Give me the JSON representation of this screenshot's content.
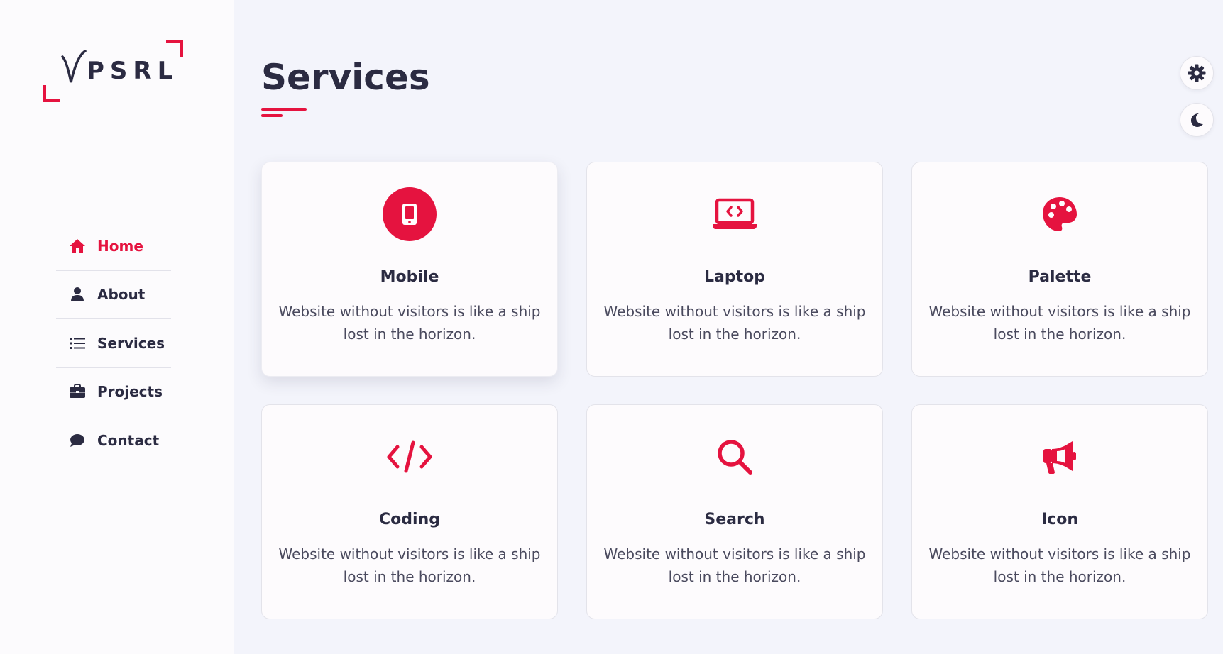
{
  "brand": {
    "logo_text": "PSRL",
    "accent": "#e5133f",
    "text_color": "#2b2b42"
  },
  "nav": {
    "items": [
      {
        "label": "Home",
        "icon": "home-icon",
        "active": true
      },
      {
        "label": "About",
        "icon": "user-icon",
        "active": false
      },
      {
        "label": "Services",
        "icon": "list-icon",
        "active": false
      },
      {
        "label": "Projects",
        "icon": "briefcase-icon",
        "active": false
      },
      {
        "label": "Contact",
        "icon": "comment-icon",
        "active": false
      }
    ]
  },
  "main": {
    "title": "Services",
    "cards": [
      {
        "icon": "mobile-icon",
        "title": "Mobile",
        "text": "Website without visitors is like a ship lost in the horizon."
      },
      {
        "icon": "laptop-code-icon",
        "title": "Laptop",
        "text": "Website without visitors is like a ship lost in the horizon."
      },
      {
        "icon": "palette-icon",
        "title": "Palette",
        "text": "Website without visitors is like a ship lost in the horizon."
      },
      {
        "icon": "code-icon",
        "title": "Coding",
        "text": "Website without visitors is like a ship lost in the horizon."
      },
      {
        "icon": "search-icon",
        "title": "Search",
        "text": "Website without visitors is like a ship lost in the horizon."
      },
      {
        "icon": "megaphone-icon",
        "title": "Icon",
        "text": "Website without visitors is like a ship lost in the horizon."
      }
    ]
  },
  "controls": {
    "settings_icon": "gear-icon",
    "theme_icon": "moon-icon"
  }
}
